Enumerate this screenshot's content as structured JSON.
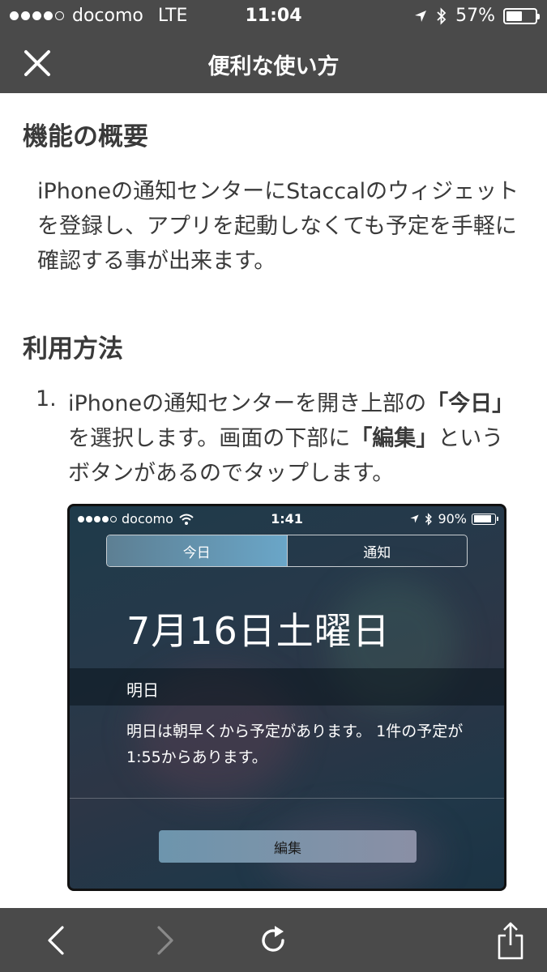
{
  "status_bar": {
    "carrier": "docomo",
    "network": "LTE",
    "time": "11:04",
    "battery": "57%",
    "battery_level": 0.57,
    "icons": [
      "location-arrow-icon",
      "bluetooth-icon",
      "battery-icon"
    ]
  },
  "nav": {
    "title": "便利な使い方",
    "close_icon": "close-icon"
  },
  "sections": {
    "overview": {
      "heading": "機能の概要",
      "body": "iPhoneの通知センターにStaccalのウィジェットを登録し、アプリを起動しなくても予定を手軽に確認する事が出来ます。"
    },
    "usage": {
      "heading": "利用方法",
      "step1": {
        "number": "1.",
        "part1": "iPhoneの通知センターを開き上部の",
        "bold1": "「今日」",
        "part2": "を選択します。画面の下部に",
        "bold2": "「編集」",
        "part3": "というボタンがあるのでタップします。"
      }
    }
  },
  "embedded_screenshot": {
    "carrier": "docomo",
    "time": "1:41",
    "battery": "90%",
    "battery_level": 0.9,
    "tab_today": "今日",
    "tab_notifications": "通知",
    "date": "7月16日土曜日",
    "section_label": "明日",
    "summary": "明日は朝早くから予定があります。 1件の予定が1:55からあります。",
    "edit_button": "編集"
  },
  "toolbar": {
    "icons": [
      "back-icon",
      "forward-icon",
      "reload-icon",
      "share-icon"
    ],
    "colors": {
      "bar": "#4a4a4a",
      "icon": "#ffffff",
      "disabled_icon": "#8a8a8a"
    }
  }
}
